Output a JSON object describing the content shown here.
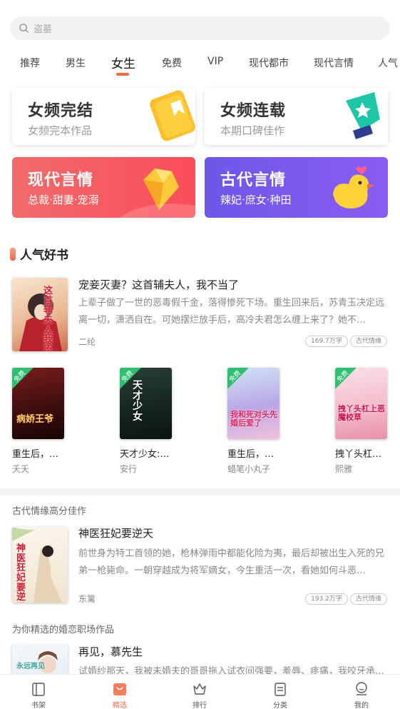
{
  "search": {
    "placeholder": "盗墓"
  },
  "tabs": [
    "推荐",
    "男生",
    "女生",
    "免费",
    "VIP",
    "现代都市",
    "现代言情",
    "人气"
  ],
  "cards": [
    {
      "title": "女频完结",
      "sub": "女频完本作品"
    },
    {
      "title": "女频连载",
      "sub": "本期口碑佳作"
    },
    {
      "title": "现代言情",
      "sub": "总裁·甜妻·宠溺"
    },
    {
      "title": "古代言情",
      "sub": "辣妃·庶女·种田"
    }
  ],
  "popular": {
    "title": "人气好书",
    "featured": {
      "title": "宠妾灭妻？这首辅夫人，我不当了",
      "desc": "上辈子做了一世的恶毒假千金，落得惨死下场。重生回来后，苏青玉决定远离一切，潇洒自在。可她摆烂放手后，高冷夫君怎么缠上来了？她不…",
      "author": "二纶",
      "count": "169.7万字",
      "genre": "古代情缘",
      "cover_text": "这首辅夫人我不当了"
    },
    "grid": [
      {
        "title": "重生后，…",
        "author": "夭夭",
        "cover_text": "病娇王爷",
        "badge": "免费"
      },
      {
        "title": "天才少女:…",
        "author": "安行",
        "cover_text": "天才少女",
        "badge": "免费"
      },
      {
        "title": "重生后，…",
        "author": "蜡笔小丸子",
        "cover_text": "我和死对头先婚后爱了",
        "badge": "免费"
      },
      {
        "title": "拽丫头杠…",
        "author": "熙雅",
        "cover_text": "拽丫头杠上恶魔校草",
        "badge": "免费"
      }
    ]
  },
  "rec1": {
    "heading": "古代情缘高分佳作",
    "title": "神医狂妃要逆天",
    "desc": "前世身为特工首领的她，枪林弹雨中都能化险为夷，最后却被出生入死的兄弟一枪毙命。一朝穿越成为将军嫡女，今生重活一次，看她如何斗恶…",
    "author": "东篱",
    "count": "193.2万字",
    "genre": "古代情缘",
    "cover_text": "神医狂妃要逆天"
  },
  "rec2": {
    "heading": "为你精选的婚恋职场作品",
    "title": "再见，慕先生",
    "desc": "试婚纱那天，我被未婚夫的哥哥拖入试衣间强要，羞辱、疼痛，我咬牙承…",
    "cover_text": "永远再见"
  },
  "nav": [
    "书架",
    "精选",
    "排行",
    "分类",
    "我的"
  ],
  "colors": {
    "accent": "#f26a4a",
    "red_card": "#f5585f",
    "purple_card": "#7b5aee"
  }
}
